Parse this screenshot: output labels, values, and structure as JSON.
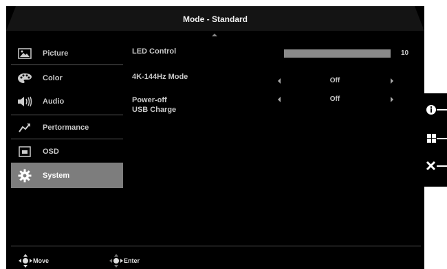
{
  "header": {
    "title": "Mode - Standard"
  },
  "sidebar": {
    "items": [
      {
        "label": "Picture",
        "icon": "picture-icon",
        "selected": false
      },
      {
        "label": "Color",
        "icon": "palette-icon",
        "selected": false
      },
      {
        "label": "Audio",
        "icon": "speaker-icon",
        "selected": false
      },
      {
        "label": "Pertormance",
        "icon": "performance-icon",
        "selected": false
      },
      {
        "label": "OSD",
        "icon": "osd-icon",
        "selected": false
      },
      {
        "label": "System",
        "icon": "gear-icon",
        "selected": true
      }
    ]
  },
  "settings": {
    "led_control": {
      "label": "LED Control",
      "value": "10",
      "level_fraction": 1.0
    },
    "mode_4k144": {
      "label": "4K-144Hz Mode",
      "value": "Off"
    },
    "power_off_usb": {
      "label_line1": "Power-off",
      "label_line2": "USB Charge",
      "value": "Off"
    }
  },
  "footer": {
    "move_label": "Move",
    "enter_label": "Enter"
  },
  "side_buttons": [
    "info-icon",
    "menu-grid-icon",
    "close-icon"
  ],
  "colors": {
    "background": "#000000",
    "selected_item": "#7d7d7d",
    "bar_fill": "#8a8a8a",
    "text": "#c8c8c8"
  }
}
